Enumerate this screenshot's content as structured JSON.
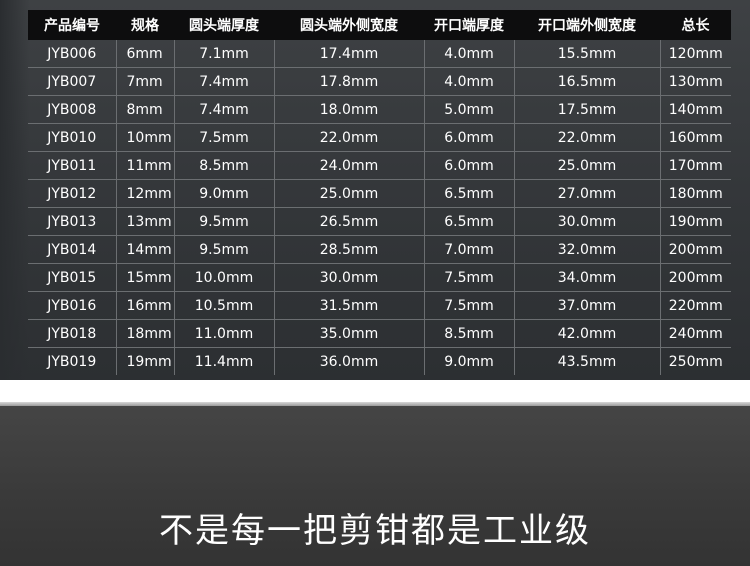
{
  "table": {
    "headers": [
      "产品编号",
      "规格",
      "圆头端厚度",
      "圆头端外侧宽度",
      "开口端厚度",
      "开口端外侧宽度",
      "总长"
    ],
    "rows": [
      [
        "JYB006",
        "6mm",
        "7.1mm",
        "17.4mm",
        "4.0mm",
        "15.5mm",
        "120mm"
      ],
      [
        "JYB007",
        "7mm",
        "7.4mm",
        "17.8mm",
        "4.0mm",
        "16.5mm",
        "130mm"
      ],
      [
        "JYB008",
        "8mm",
        "7.4mm",
        "18.0mm",
        "5.0mm",
        "17.5mm",
        "140mm"
      ],
      [
        "JYB010",
        "10mm",
        "7.5mm",
        "22.0mm",
        "6.0mm",
        "22.0mm",
        "160mm"
      ],
      [
        "JYB011",
        "11mm",
        "8.5mm",
        "24.0mm",
        "6.0mm",
        "25.0mm",
        "170mm"
      ],
      [
        "JYB012",
        "12mm",
        "9.0mm",
        "25.0mm",
        "6.5mm",
        "27.0mm",
        "180mm"
      ],
      [
        "JYB013",
        "13mm",
        "9.5mm",
        "26.5mm",
        "6.5mm",
        "30.0mm",
        "190mm"
      ],
      [
        "JYB014",
        "14mm",
        "9.5mm",
        "28.5mm",
        "7.0mm",
        "32.0mm",
        "200mm"
      ],
      [
        "JYB015",
        "15mm",
        "10.0mm",
        "30.0mm",
        "7.5mm",
        "34.0mm",
        "200mm"
      ],
      [
        "JYB016",
        "16mm",
        "10.5mm",
        "31.5mm",
        "7.5mm",
        "37.0mm",
        "220mm"
      ],
      [
        "JYB018",
        "18mm",
        "11.0mm",
        "35.0mm",
        "8.5mm",
        "42.0mm",
        "240mm"
      ],
      [
        "JYB019",
        "19mm",
        "11.4mm",
        "36.0mm",
        "9.0mm",
        "43.5mm",
        "250mm"
      ]
    ]
  },
  "tagline": "不是每一把剪钳都是工业级",
  "colors": {
    "header_bg": "#0d0d0e",
    "panel_bg": "#36393c",
    "text": "#ffffff",
    "grid_line": "#6b6e71"
  }
}
